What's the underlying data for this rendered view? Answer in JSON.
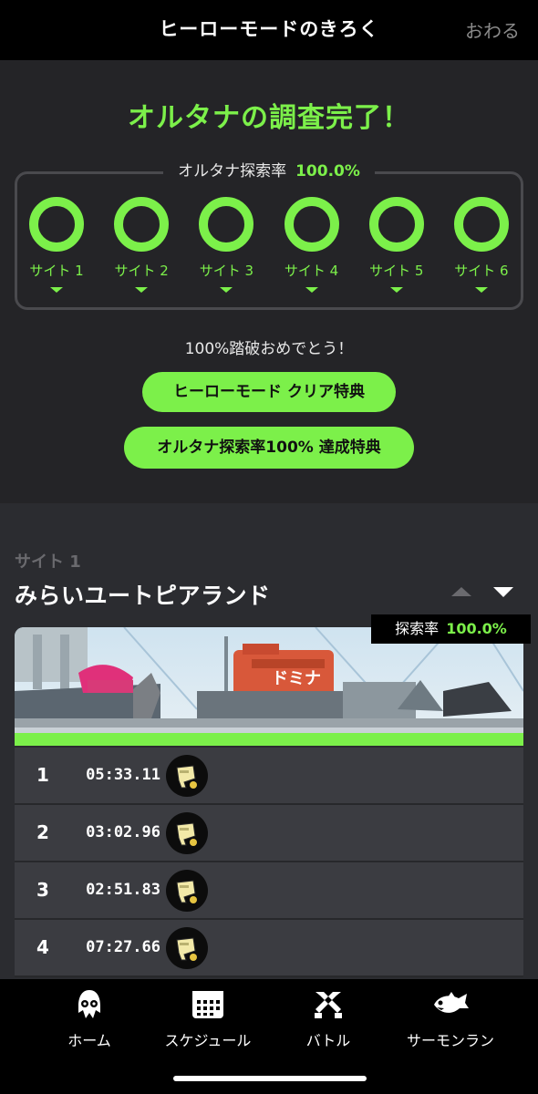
{
  "header": {
    "title": "ヒーローモードのきろく",
    "close_label": "おわる"
  },
  "summary": {
    "headline": "オルタナの調査完了！",
    "exploration_label": "オルタナ探索率",
    "exploration_value": "100.0%",
    "sites": [
      {
        "label": "サイト 1",
        "progress": 1.0
      },
      {
        "label": "サイト 2",
        "progress": 1.0
      },
      {
        "label": "サイト 3",
        "progress": 1.0
      },
      {
        "label": "サイト 4",
        "progress": 1.0
      },
      {
        "label": "サイト 5",
        "progress": 1.0
      },
      {
        "label": "サイト 6",
        "progress": 1.0
      }
    ],
    "congrats": "100%踏破おめでとう！",
    "reward_button_1": "ヒーローモード クリア特典",
    "reward_button_2": "オルタナ探索率100% 達成特典"
  },
  "site_detail": {
    "site_number": "サイト 1",
    "stage_name": "みらいユートピアランド",
    "rate_label": "探索率",
    "rate_value": "100.0%",
    "progress": 1.0,
    "records": [
      {
        "num": "1",
        "time": "05:33.11"
      },
      {
        "num": "2",
        "time": "03:02.96"
      },
      {
        "num": "3",
        "time": "02:51.83"
      },
      {
        "num": "4",
        "time": "07:27.66"
      }
    ]
  },
  "tabbar": {
    "tabs": [
      {
        "label": "ホーム",
        "icon": "squid-icon"
      },
      {
        "label": "スケジュール",
        "icon": "calendar-icon"
      },
      {
        "label": "バトル",
        "icon": "battle-icon"
      },
      {
        "label": "サーモンラン",
        "icon": "salmon-icon"
      }
    ]
  },
  "colors": {
    "accent": "#7cf04a",
    "panel": "#242427",
    "row": "#3b3c41"
  }
}
